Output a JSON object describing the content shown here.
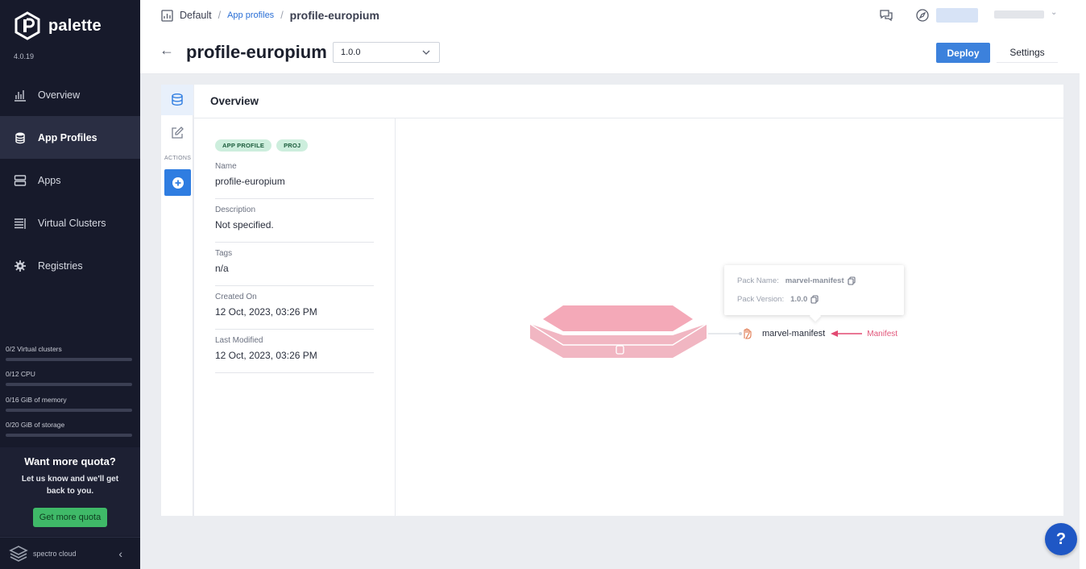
{
  "sidebar": {
    "logo_text": "palette",
    "version": "4.0.19",
    "nav": [
      {
        "label": "Overview",
        "icon": "chart-icon",
        "active": false
      },
      {
        "label": "App Profiles",
        "icon": "stack-icon",
        "active": true
      },
      {
        "label": "Apps",
        "icon": "server-icon",
        "active": false
      },
      {
        "label": "Virtual Clusters",
        "icon": "list-icon",
        "active": false
      },
      {
        "label": "Registries",
        "icon": "gear-icon",
        "active": false
      }
    ],
    "quotas": [
      {
        "label": "0/2 Virtual clusters",
        "fraction": 0
      },
      {
        "label": "0/12 CPU",
        "fraction": 0
      },
      {
        "label": "0/16 GiB of memory",
        "fraction": 0
      },
      {
        "label": "0/20 GiB of storage",
        "fraction": 0
      }
    ],
    "promo": {
      "title": "Want more quota?",
      "text": "Let us know and we'll get back to you.",
      "button": "Get more quota"
    },
    "footer_text": "spectro cloud"
  },
  "header": {
    "breadcrumb": {
      "root": "Default",
      "link": "App profiles",
      "current": "profile-europium"
    },
    "title": "profile-europium",
    "version_selected": "1.0.0",
    "deploy_label": "Deploy",
    "settings_label": "Settings"
  },
  "actions": {
    "label": "ACTIONS"
  },
  "panel": {
    "title": "Overview",
    "badges": [
      "APP PROFILE",
      "PROJ"
    ],
    "fields": [
      {
        "label": "Name",
        "value": "profile-europium"
      },
      {
        "label": "Description",
        "value": "Not specified."
      },
      {
        "label": "Tags",
        "value": "n/a"
      },
      {
        "label": "Created On",
        "value": "12 Oct, 2023, 03:26 PM"
      },
      {
        "label": "Last Modified",
        "value": "12 Oct, 2023, 03:26 PM"
      }
    ]
  },
  "canvas": {
    "tooltip": {
      "pack_name_label": "Pack Name:",
      "pack_name": "marvel-manifest",
      "pack_version_label": "Pack Version:",
      "pack_version": "1.0.0"
    },
    "pack_name": "marvel-manifest",
    "manifest_label": "Manifest",
    "layer_color": "#f4a9b8"
  },
  "help_label": "?"
}
